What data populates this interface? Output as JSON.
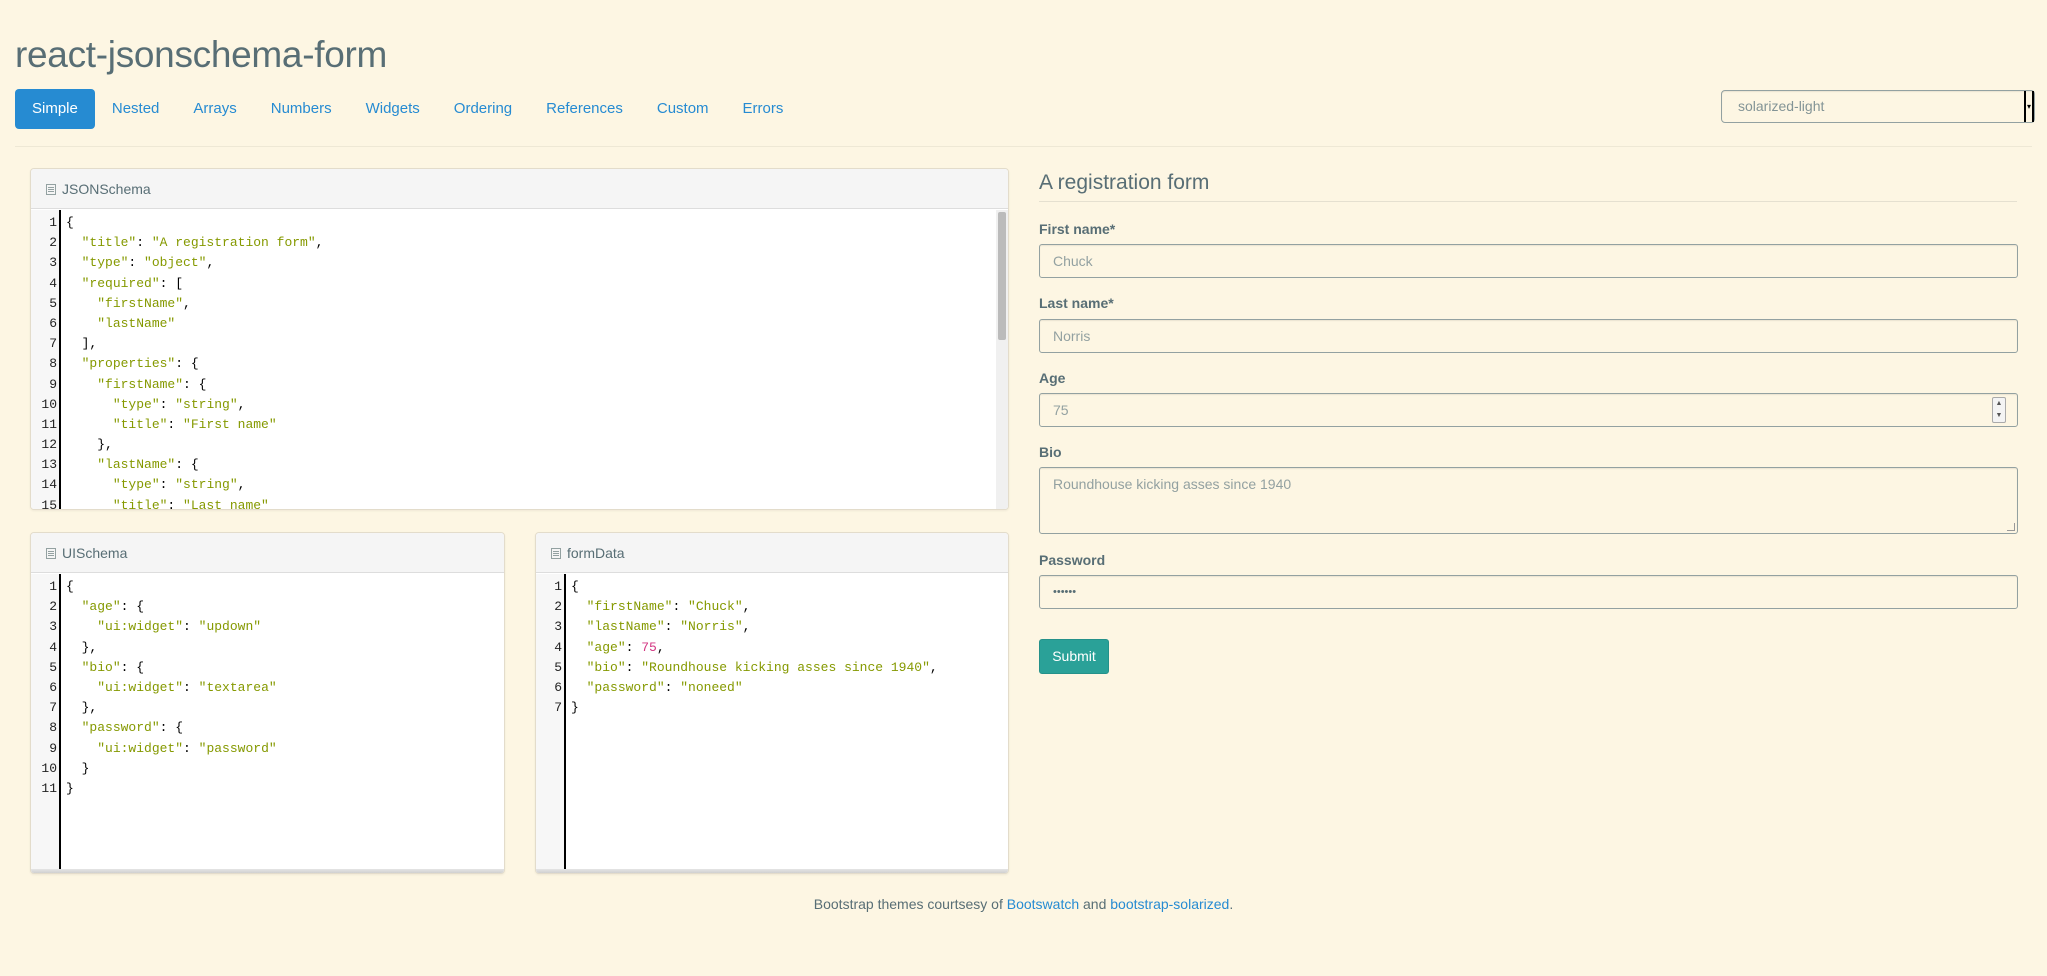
{
  "app": {
    "title": "react-jsonschema-form"
  },
  "nav": {
    "tabs": [
      {
        "label": "Simple",
        "active": true
      },
      {
        "label": "Nested"
      },
      {
        "label": "Arrays"
      },
      {
        "label": "Numbers"
      },
      {
        "label": "Widgets"
      },
      {
        "label": "Ordering"
      },
      {
        "label": "References"
      },
      {
        "label": "Custom"
      },
      {
        "label": "Errors"
      }
    ]
  },
  "theme_select": {
    "value": "solarized-light"
  },
  "panels": {
    "jsonschema": {
      "title": "JSONSchema",
      "lines": [
        [
          [
            "p",
            "{"
          ]
        ],
        [
          [
            "p",
            "  "
          ],
          [
            "k",
            "\"title\""
          ],
          [
            "p",
            ": "
          ],
          [
            "s",
            "\"A registration form\""
          ],
          [
            "p",
            ","
          ]
        ],
        [
          [
            "p",
            "  "
          ],
          [
            "k",
            "\"type\""
          ],
          [
            "p",
            ": "
          ],
          [
            "s",
            "\"object\""
          ],
          [
            "p",
            ","
          ]
        ],
        [
          [
            "p",
            "  "
          ],
          [
            "k",
            "\"required\""
          ],
          [
            "p",
            ": ["
          ]
        ],
        [
          [
            "p",
            "    "
          ],
          [
            "s",
            "\"firstName\""
          ],
          [
            "p",
            ","
          ]
        ],
        [
          [
            "p",
            "    "
          ],
          [
            "s",
            "\"lastName\""
          ]
        ],
        [
          [
            "p",
            "  ],"
          ]
        ],
        [
          [
            "p",
            "  "
          ],
          [
            "k",
            "\"properties\""
          ],
          [
            "p",
            ": {"
          ]
        ],
        [
          [
            "p",
            "    "
          ],
          [
            "k",
            "\"firstName\""
          ],
          [
            "p",
            ": {"
          ]
        ],
        [
          [
            "p",
            "      "
          ],
          [
            "k",
            "\"type\""
          ],
          [
            "p",
            ": "
          ],
          [
            "s",
            "\"string\""
          ],
          [
            "p",
            ","
          ]
        ],
        [
          [
            "p",
            "      "
          ],
          [
            "k",
            "\"title\""
          ],
          [
            "p",
            ": "
          ],
          [
            "s",
            "\"First name\""
          ]
        ],
        [
          [
            "p",
            "    },"
          ]
        ],
        [
          [
            "p",
            "    "
          ],
          [
            "k",
            "\"lastName\""
          ],
          [
            "p",
            ": {"
          ]
        ],
        [
          [
            "p",
            "      "
          ],
          [
            "k",
            "\"type\""
          ],
          [
            "p",
            ": "
          ],
          [
            "s",
            "\"string\""
          ],
          [
            "p",
            ","
          ]
        ],
        [
          [
            "p",
            "      "
          ],
          [
            "k",
            "\"title\""
          ],
          [
            "p",
            ": "
          ],
          [
            "s",
            "\"Last name\""
          ]
        ]
      ]
    },
    "uischema": {
      "title": "UISchema",
      "lines": [
        [
          [
            "p",
            "{"
          ]
        ],
        [
          [
            "p",
            "  "
          ],
          [
            "k",
            "\"age\""
          ],
          [
            "p",
            ": {"
          ]
        ],
        [
          [
            "p",
            "    "
          ],
          [
            "k",
            "\"ui:widget\""
          ],
          [
            "p",
            ": "
          ],
          [
            "s",
            "\"updown\""
          ]
        ],
        [
          [
            "p",
            "  },"
          ]
        ],
        [
          [
            "p",
            "  "
          ],
          [
            "k",
            "\"bio\""
          ],
          [
            "p",
            ": {"
          ]
        ],
        [
          [
            "p",
            "    "
          ],
          [
            "k",
            "\"ui:widget\""
          ],
          [
            "p",
            ": "
          ],
          [
            "s",
            "\"textarea\""
          ]
        ],
        [
          [
            "p",
            "  },"
          ]
        ],
        [
          [
            "p",
            "  "
          ],
          [
            "k",
            "\"password\""
          ],
          [
            "p",
            ": {"
          ]
        ],
        [
          [
            "p",
            "    "
          ],
          [
            "k",
            "\"ui:widget\""
          ],
          [
            "p",
            ": "
          ],
          [
            "s",
            "\"password\""
          ]
        ],
        [
          [
            "p",
            "  }"
          ]
        ],
        [
          [
            "p",
            "}"
          ]
        ]
      ]
    },
    "formdata": {
      "title": "formData",
      "lines": [
        [
          [
            "p",
            "{"
          ]
        ],
        [
          [
            "p",
            "  "
          ],
          [
            "k",
            "\"firstName\""
          ],
          [
            "p",
            ": "
          ],
          [
            "s",
            "\"Chuck\""
          ],
          [
            "p",
            ","
          ]
        ],
        [
          [
            "p",
            "  "
          ],
          [
            "k",
            "\"lastName\""
          ],
          [
            "p",
            ": "
          ],
          [
            "s",
            "\"Norris\""
          ],
          [
            "p",
            ","
          ]
        ],
        [
          [
            "p",
            "  "
          ],
          [
            "k",
            "\"age\""
          ],
          [
            "p",
            ": "
          ],
          [
            "n",
            "75"
          ],
          [
            "p",
            ","
          ]
        ],
        [
          [
            "p",
            "  "
          ],
          [
            "k",
            "\"bio\""
          ],
          [
            "p",
            ": "
          ],
          [
            "s",
            "\"Roundhouse kicking asses since 1940\""
          ],
          [
            "p",
            ","
          ]
        ],
        [
          [
            "p",
            "  "
          ],
          [
            "k",
            "\"password\""
          ],
          [
            "p",
            ": "
          ],
          [
            "s",
            "\"noneed\""
          ]
        ],
        [
          [
            "p",
            "}"
          ]
        ]
      ]
    }
  },
  "form": {
    "legend": "A registration form",
    "fields": {
      "first_name": {
        "label": "First name*",
        "value": "Chuck"
      },
      "last_name": {
        "label": "Last name*",
        "value": "Norris"
      },
      "age": {
        "label": "Age",
        "value": "75"
      },
      "bio": {
        "label": "Bio",
        "value": "Roundhouse kicking asses since 1940"
      },
      "password": {
        "label": "Password",
        "value": "••••••"
      }
    },
    "submit_label": "Submit"
  },
  "footer": {
    "prefix": "Bootstrap themes courtsesy of ",
    "link1": "Bootswatch",
    "middle": " and ",
    "link2": "bootstrap-solarized",
    "suffix": "."
  }
}
